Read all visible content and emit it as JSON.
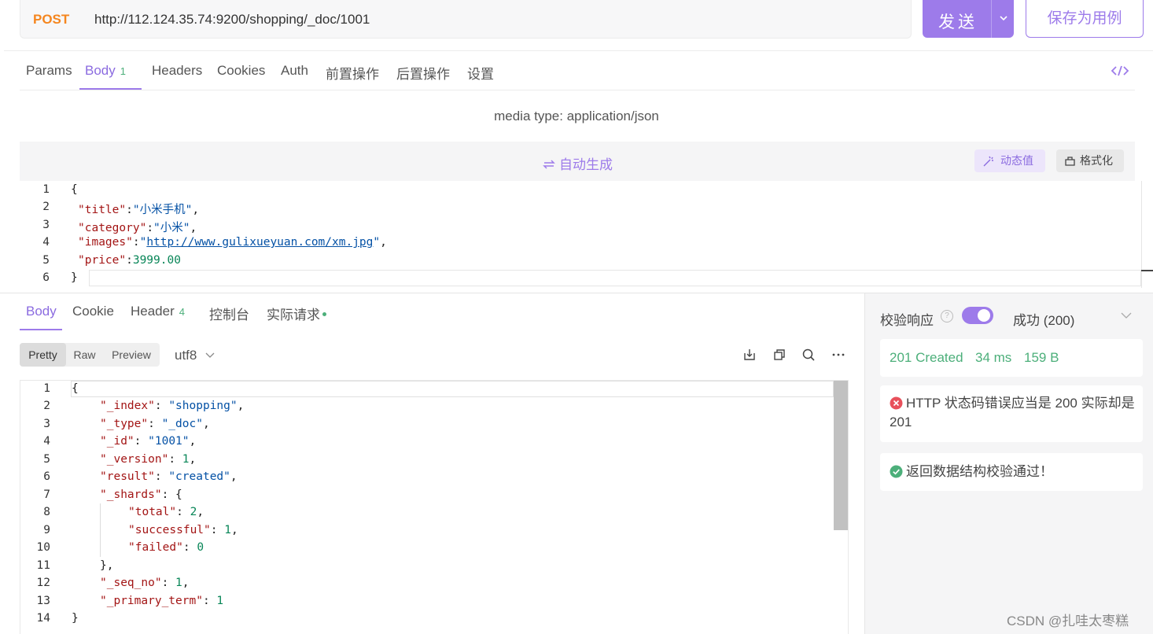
{
  "request": {
    "method": "POST",
    "url": "http://112.124.35.74:9200/shopping/_doc/1001",
    "send_label": "发送",
    "save_label": "保存为用例"
  },
  "request_tabs": {
    "params": "Params",
    "body": "Body",
    "body_badge": "1",
    "headers": "Headers",
    "cookies": "Cookies",
    "auth": "Auth",
    "pre": "前置操作",
    "post": "后置操作",
    "settings": "设置"
  },
  "media_type": "media type: application/json",
  "auto_generate": "自动生成",
  "dynamic_value": "动态值",
  "format": "格式化",
  "request_body": {
    "line_numbers": [
      "1",
      "2",
      "3",
      "4",
      "5",
      "6"
    ],
    "title_key": "\"title\"",
    "title_value": "\"小米手机\"",
    "category_key": "\"category\"",
    "category_value": "\"小米\"",
    "images_key": "\"images\"",
    "images_value": "http://www.gulixueyuan.com/xm.jpg",
    "price_key": "\"price\"",
    "price_value": "3999.00"
  },
  "response_tabs": {
    "body": "Body",
    "cookie": "Cookie",
    "header": "Header",
    "header_badge": "4",
    "console": "控制台",
    "actual": "实际请求"
  },
  "view_modes": {
    "pretty": "Pretty",
    "raw": "Raw",
    "preview": "Preview",
    "selected": "Pretty"
  },
  "encoding": "utf8",
  "response_body": {
    "line_numbers": [
      "1",
      "2",
      "3",
      "4",
      "5",
      "6",
      "7",
      "8",
      "9",
      "10",
      "11",
      "12",
      "13",
      "14"
    ],
    "index_key": "\"_index\"",
    "index_value": "\"shopping\"",
    "type_key": "\"_type\"",
    "type_value": "\"_doc\"",
    "id_key": "\"_id\"",
    "id_value": "\"1001\"",
    "version_key": "\"_version\"",
    "version_value": "1",
    "result_key": "\"result\"",
    "result_value": "\"created\"",
    "shards_key": "\"_shards\"",
    "total_key": "\"total\"",
    "total_value": "2",
    "successful_key": "\"successful\"",
    "successful_value": "1",
    "failed_key": "\"failed\"",
    "failed_value": "0",
    "seq_key": "\"_seq_no\"",
    "seq_value": "1",
    "primary_key": "\"_primary_term\"",
    "primary_value": "1"
  },
  "validation": {
    "title": "校验响应",
    "help": "?",
    "status": "成功 (200)",
    "status_code": "201 Created",
    "time": "34 ms",
    "size": "159 B",
    "error_message": "HTTP 状态码错误应当是 200 实际却是 201",
    "success_message": "返回数据结构校验通过！"
  },
  "watermark": "CSDN @扎哇太枣糕",
  "colors": {
    "accent": "#9d7bea",
    "method": "#f5861f",
    "success": "#4caf7a",
    "error": "#e8505b"
  }
}
